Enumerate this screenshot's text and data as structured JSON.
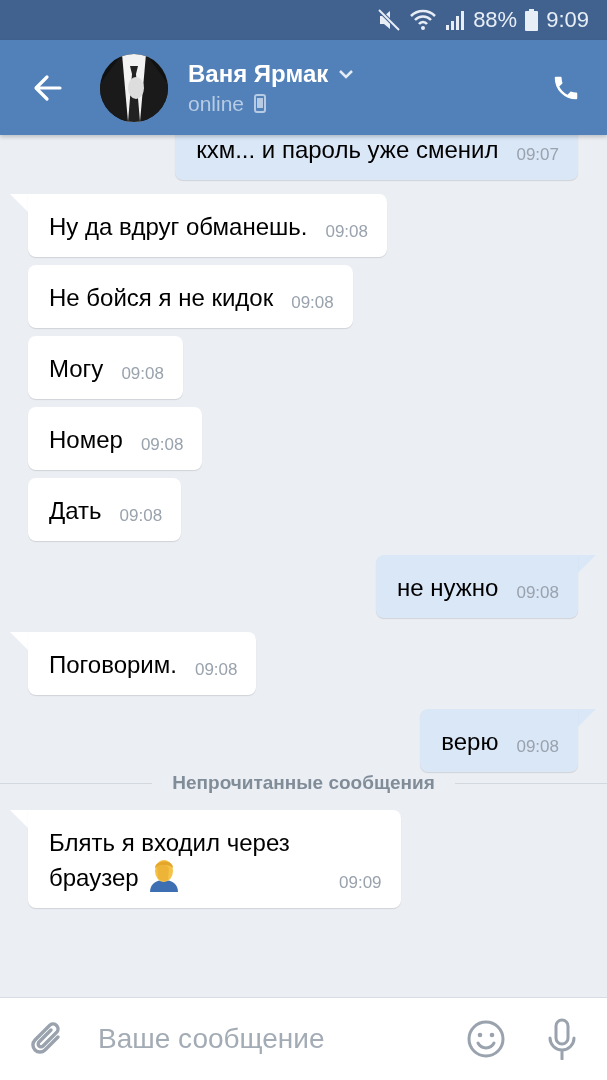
{
  "status_bar": {
    "battery": "88%",
    "time": "9:09"
  },
  "header": {
    "name": "Ваня Ярмак",
    "status": "online"
  },
  "messages": [
    {
      "kind": "out",
      "text": "кхм... и пароль уже сменил",
      "time": "09:07"
    },
    {
      "kind": "in",
      "text": "Ну да вдруг обманешь.",
      "time": "09:08",
      "tail": true
    },
    {
      "kind": "in",
      "text": "Не бойся я не кидок",
      "time": "09:08",
      "tail": false
    },
    {
      "kind": "in",
      "text": "Могу",
      "time": "09:08",
      "tail": false
    },
    {
      "kind": "in",
      "text": "Номер",
      "time": "09:08",
      "tail": false
    },
    {
      "kind": "in",
      "text": "Дать",
      "time": "09:08",
      "tail": false
    },
    {
      "kind": "out",
      "text": "не нужно",
      "time": "09:08",
      "tail": true
    },
    {
      "kind": "in",
      "text": "Поговорим.",
      "time": "09:08",
      "tail": true
    },
    {
      "kind": "out",
      "text": "верю",
      "time": "09:08",
      "tail": true
    },
    {
      "kind": "divider",
      "text": "Непрочитанные сообщения"
    },
    {
      "kind": "in",
      "text": "Блять я входил через браузер",
      "time": "09:09",
      "tail": true,
      "trailing_icon": true
    }
  ],
  "composer": {
    "placeholder": "Ваше сообщение"
  }
}
